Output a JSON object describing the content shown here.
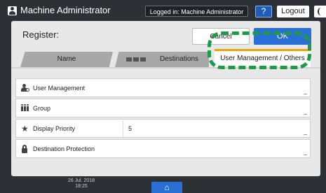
{
  "header": {
    "title": "Machine Administrator",
    "login_status": "Logged in: Machine Administrator",
    "help_label": "?",
    "logout_label": "Logout",
    "user_icon": "user-icon",
    "night_icon": "moon-icon"
  },
  "register": {
    "title": "Register:",
    "cancel_label": "Cancel",
    "ok_label": "OK"
  },
  "tabs": [
    {
      "label": "Name"
    },
    {
      "label": "Destinations",
      "icon": "destination-type-icons"
    },
    {
      "label": "User Management / Others",
      "selected": true
    }
  ],
  "rows": [
    {
      "label": "User Management",
      "value": "",
      "icon": "user-key-icon"
    },
    {
      "label": "Group",
      "value": "",
      "icon": "group-icon"
    },
    {
      "label": "Display Priority",
      "value": "5",
      "icon": "star-icon"
    },
    {
      "label": "Destination Protection",
      "value": "",
      "icon": "lock-icon"
    }
  ],
  "footer": {
    "date": "26 Jul. 2018",
    "time": "18:25",
    "home_icon": "home-icon"
  },
  "colors": {
    "accent": "#2a6fd6",
    "tab_selected_bar": "#e8a400",
    "callout": "#1f9b48",
    "chrome": "#2d3136"
  }
}
